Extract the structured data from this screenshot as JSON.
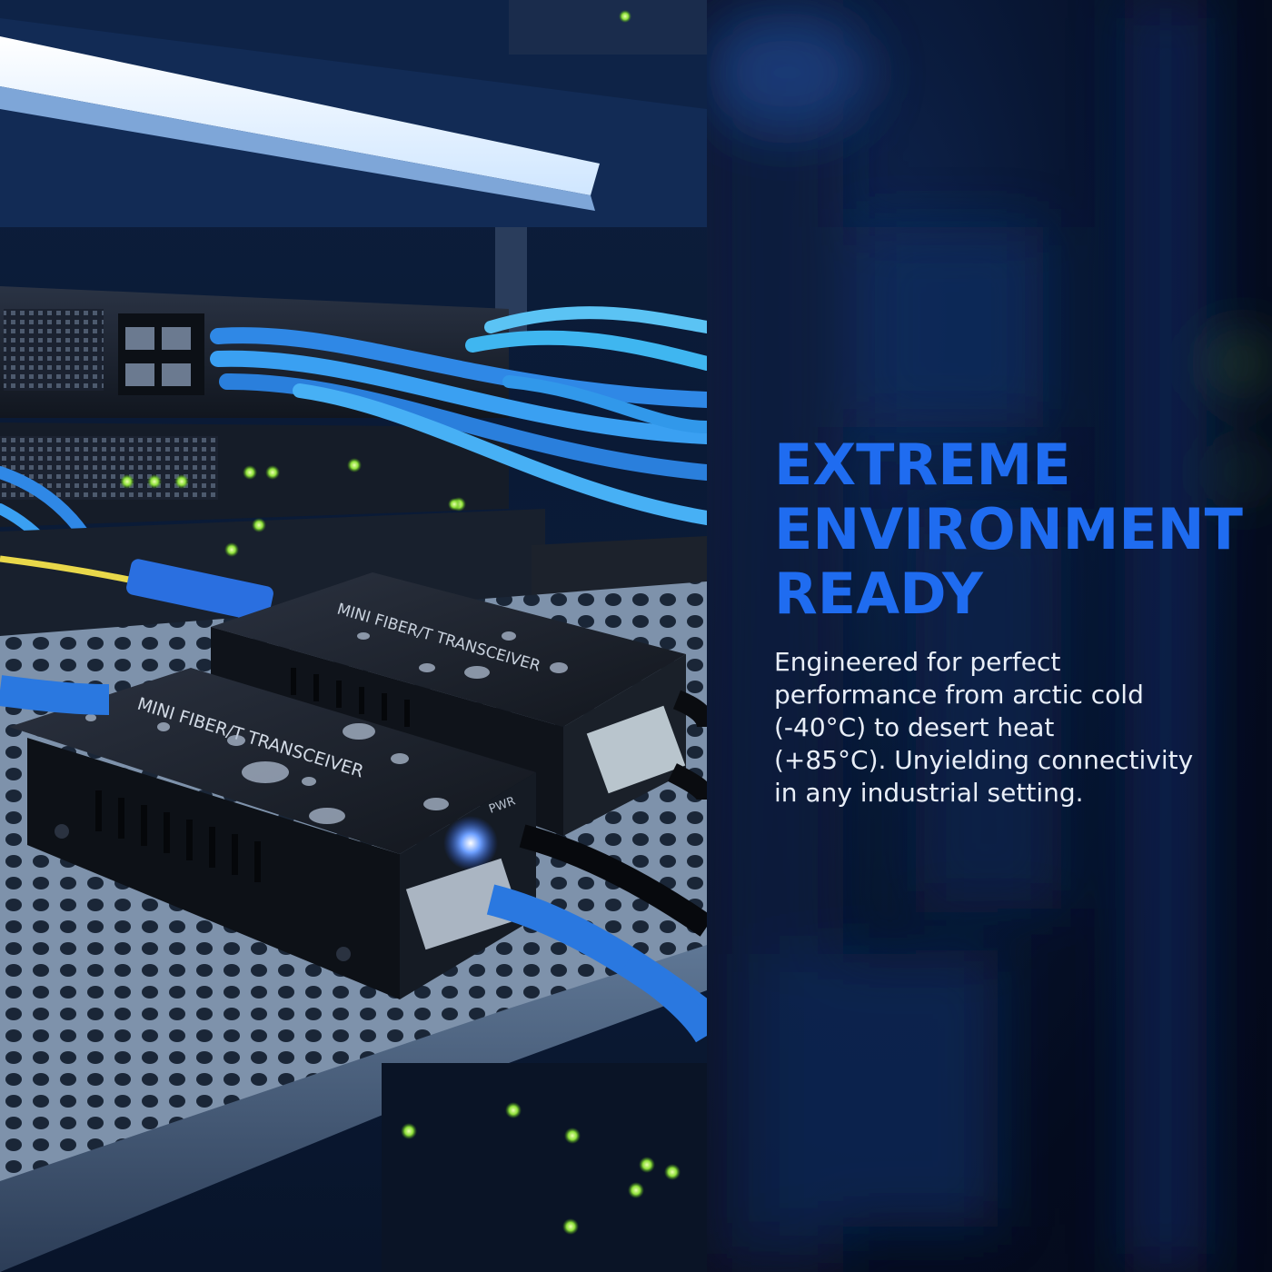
{
  "headline": {
    "lines": [
      "EXTREME",
      "ENVIRONMENT",
      "READY"
    ]
  },
  "body": {
    "lines": [
      "Engineered for perfect",
      "performance from arctic cold",
      "(-40°C) to desert heat",
      "(+85°C). Unyielding connectivity",
      "in any industrial setting."
    ]
  },
  "devices": {
    "label": "MINI FIBER/T TRANSCEIVER",
    "port_label_power": "PWR"
  },
  "colors": {
    "accent_blue": "#1f6cf0",
    "body_text": "#e8eef8",
    "background": "#060d20"
  }
}
